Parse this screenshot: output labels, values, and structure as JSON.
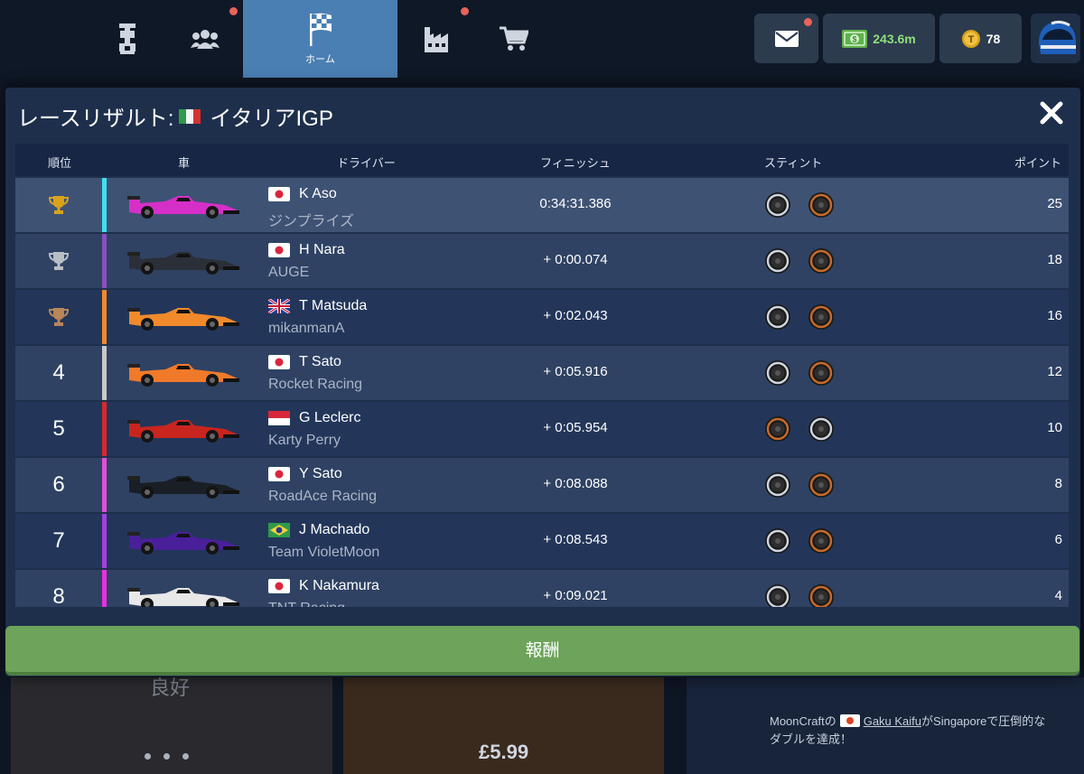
{
  "nav": {
    "items": [
      {
        "icon": "car-icon",
        "label": ""
      },
      {
        "icon": "people-icon",
        "label": "",
        "notification": true
      },
      {
        "icon": "checkered-flag-icon",
        "label": "ホーム",
        "active": true
      },
      {
        "icon": "factory-icon",
        "label": "",
        "notification": true
      },
      {
        "icon": "cart-icon",
        "label": ""
      }
    ],
    "mail_notification": true,
    "money": "243.6m",
    "tokens": "78"
  },
  "modal": {
    "title_prefix": "レースリザルト:",
    "title_race": "イタリアIGP",
    "title_flag": "italy"
  },
  "columns": {
    "pos": "順位",
    "car": "車",
    "driver": "ドライバー",
    "finish": "フィニッシュ",
    "stint": "スティント",
    "points": "ポイント"
  },
  "results": [
    {
      "pos": "",
      "trophy": "gold",
      "stripe": "#3fe0f0",
      "car_color": "#d62fc8",
      "flag": "japan",
      "driver": "K Aso",
      "team": "ジンプライズ",
      "finish": "0:34:31.386",
      "stints": [
        "medium",
        "soft"
      ],
      "points": "25"
    },
    {
      "pos": "",
      "trophy": "silver",
      "stripe": "#8a4fc0",
      "car_color": "#2b2f38",
      "flag": "japan",
      "driver": "H Nara",
      "team": "AUGE",
      "finish": "+ 0:00.074",
      "stints": [
        "medium",
        "soft"
      ],
      "points": "18"
    },
    {
      "pos": "",
      "trophy": "bronze",
      "stripe": "#f08a2a",
      "car_color": "#f08a2a",
      "flag": "uk",
      "driver": "T Matsuda",
      "team": "mikanmanA",
      "finish": "+ 0:02.043",
      "stints": [
        "medium",
        "soft"
      ],
      "points": "16"
    },
    {
      "pos": "4",
      "trophy": "",
      "stripe": "#c9c9c9",
      "car_color": "#f07a2a",
      "flag": "japan",
      "driver": "T Sato",
      "team": "Rocket Racing",
      "finish": "+ 0:05.916",
      "stints": [
        "medium",
        "soft"
      ],
      "points": "12"
    },
    {
      "pos": "5",
      "trophy": "",
      "stripe": "#d8282a",
      "car_color": "#c8251e",
      "flag": "monaco",
      "driver": "G Leclerc",
      "team": "Karty Perry",
      "finish": "+ 0:05.954",
      "stints": [
        "soft",
        "medium"
      ],
      "points": "10"
    },
    {
      "pos": "6",
      "trophy": "",
      "stripe": "#e04fd8",
      "car_color": "#1a1f26",
      "flag": "japan",
      "driver": "Y Sato",
      "team": "RoadAce Racing",
      "finish": "+ 0:08.088",
      "stints": [
        "medium",
        "soft"
      ],
      "points": "8"
    },
    {
      "pos": "7",
      "trophy": "",
      "stripe": "#a43fe0",
      "car_color": "#4a1f9a",
      "flag": "brazil",
      "driver": "J Machado",
      "team": "Team VioletMoon",
      "finish": "+ 0:08.543",
      "stints": [
        "medium",
        "soft"
      ],
      "points": "6"
    },
    {
      "pos": "8",
      "trophy": "",
      "stripe": "#e82fe0",
      "car_color": "#e8e8e8",
      "flag": "japan",
      "driver": "K Nakamura",
      "team": "TNT Racing",
      "finish": "+ 0:09.021",
      "stints": [
        "medium",
        "soft"
      ],
      "points": "4"
    }
  ],
  "reward_button": "報酬",
  "background": {
    "faded_text": "良好",
    "price": "£5.99",
    "news_line1_prefix": "MoonCraftの",
    "news_line1_name": "Gaku Kaifu",
    "news_line1_suffix": "がSingaporeで圧倒的な",
    "news_line2": "ダブルを達成！"
  },
  "colors": {
    "gold": "#d9a21c",
    "silver": "#b9bec6",
    "bronze": "#b9865a",
    "reward": "#6da35a",
    "notification": "#e8635a"
  }
}
